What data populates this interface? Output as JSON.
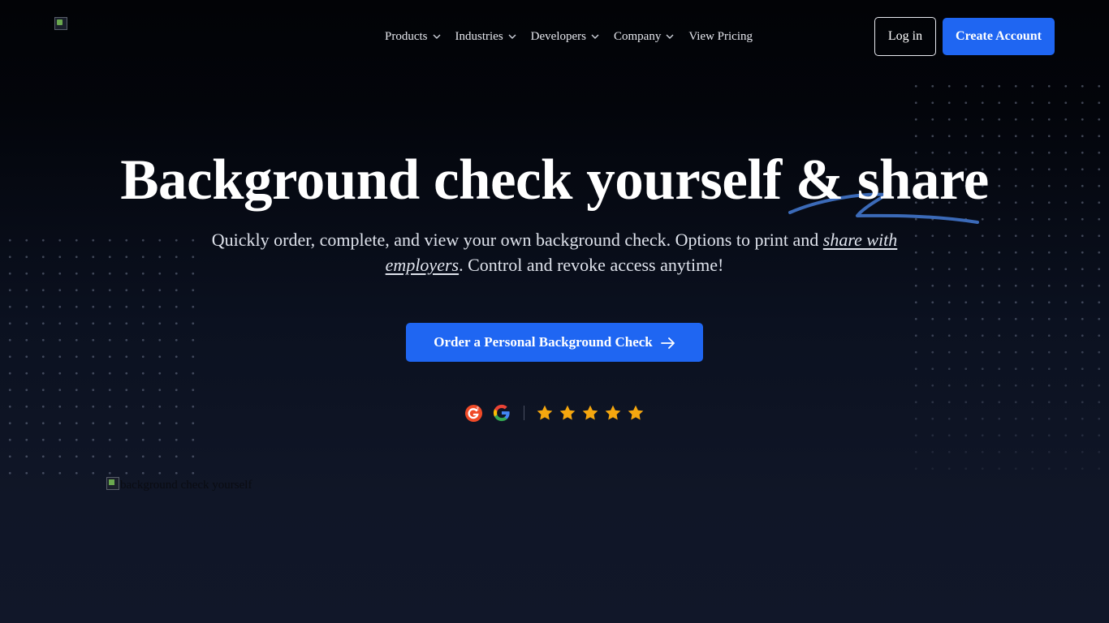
{
  "header": {
    "logo_icon": "broken-image-icon",
    "nav": [
      {
        "label": "Products",
        "has_dropdown": true
      },
      {
        "label": "Industries",
        "has_dropdown": true
      },
      {
        "label": "Developers",
        "has_dropdown": true
      },
      {
        "label": "Company",
        "has_dropdown": true
      },
      {
        "label": "View Pricing",
        "has_dropdown": false
      }
    ],
    "login_label": "Log in",
    "create_account_label": "Create Account"
  },
  "hero": {
    "title": "Background check yourself & share",
    "subtitle_before": "Quickly order, complete, and view your own background check. Options to print and ",
    "subtitle_link": "share with employers",
    "subtitle_after": ". Control and revoke access anytime!",
    "cta_label": "Order a Personal Background Check",
    "cta_icon": "arrow-right-icon",
    "rating": {
      "sources": [
        "g2-logo-icon",
        "google-logo-icon"
      ],
      "stars": 5
    },
    "image_alt": "background check yourself"
  },
  "colors": {
    "accent": "#1f66f2",
    "swoosh": "#3b6ab8",
    "star": "#f5a70f",
    "text": "#ffffff"
  }
}
